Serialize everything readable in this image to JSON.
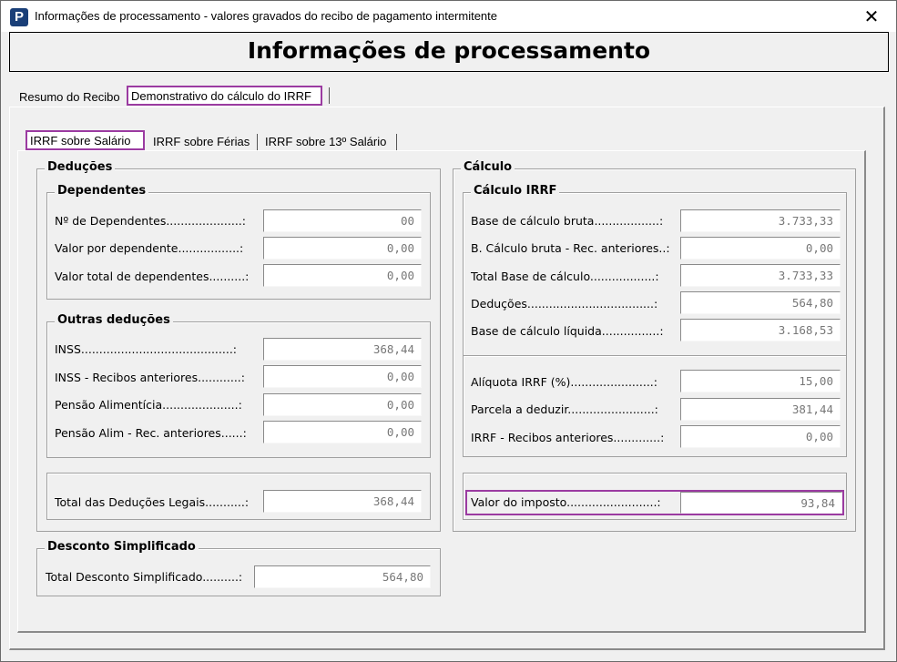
{
  "window": {
    "title": "Informações de processamento - valores gravados do recibo de pagamento intermitente",
    "icon": "P",
    "close": "✕"
  },
  "header": {
    "title": "Informações de processamento"
  },
  "main_tabs": [
    {
      "label": "Resumo do Recibo"
    },
    {
      "label": "Demonstrativo do cálculo do IRRF"
    }
  ],
  "sub_tabs": [
    {
      "label": "IRRF sobre Salário"
    },
    {
      "label": "IRRF sobre Férias"
    },
    {
      "label": "IRRF sobre 13º Salário"
    }
  ],
  "deducoes": {
    "title": "Deduções",
    "dependentes": {
      "title": "Dependentes",
      "rows": [
        {
          "label": "Nº de Dependentes.....................:",
          "value": "00"
        },
        {
          "label": "Valor por dependente.................:",
          "value": "0,00"
        },
        {
          "label": "Valor total de dependentes..........:",
          "value": "0,00"
        }
      ]
    },
    "outras": {
      "title": "Outras deduções",
      "rows": [
        {
          "label": "INSS..........................................:",
          "value": "368,44"
        },
        {
          "label": "INSS - Recibos anteriores............:",
          "value": "0,00"
        },
        {
          "label": "Pensão Alimentícia.....................:",
          "value": "0,00"
        },
        {
          "label": "Pensão Alim - Rec. anteriores......:",
          "value": "0,00"
        }
      ]
    },
    "total": {
      "label": "Total das Deduções Legais...........:",
      "value": "368,44"
    }
  },
  "desconto": {
    "title": "Desconto Simplificado",
    "row": {
      "label": "Total Desconto Simplificado..........:",
      "value": "564,80"
    }
  },
  "calculo": {
    "title": "Cálculo",
    "irrf": {
      "title": "Cálculo IRRF",
      "base_rows": [
        {
          "label": "Base de cálculo bruta..................:",
          "value": "3.733,33"
        },
        {
          "label": "B. Cálculo bruta - Rec. anteriores..:",
          "value": "0,00"
        },
        {
          "label": "Total Base de cálculo..................:",
          "value": "3.733,33"
        },
        {
          "label": "Deduções...................................:",
          "value": "564,80"
        },
        {
          "label": "Base de cálculo líquida................:",
          "value": "3.168,53"
        }
      ],
      "rate_rows": [
        {
          "label": "Alíquota IRRF (%).......................:",
          "value": "15,00"
        },
        {
          "label": "Parcela a deduzir........................:",
          "value": "381,44"
        },
        {
          "label": "IRRF - Recibos anteriores.............:",
          "value": "0,00"
        }
      ]
    },
    "imposto": {
      "label": "Valor do imposto.........................:",
      "value": "93,84"
    }
  }
}
